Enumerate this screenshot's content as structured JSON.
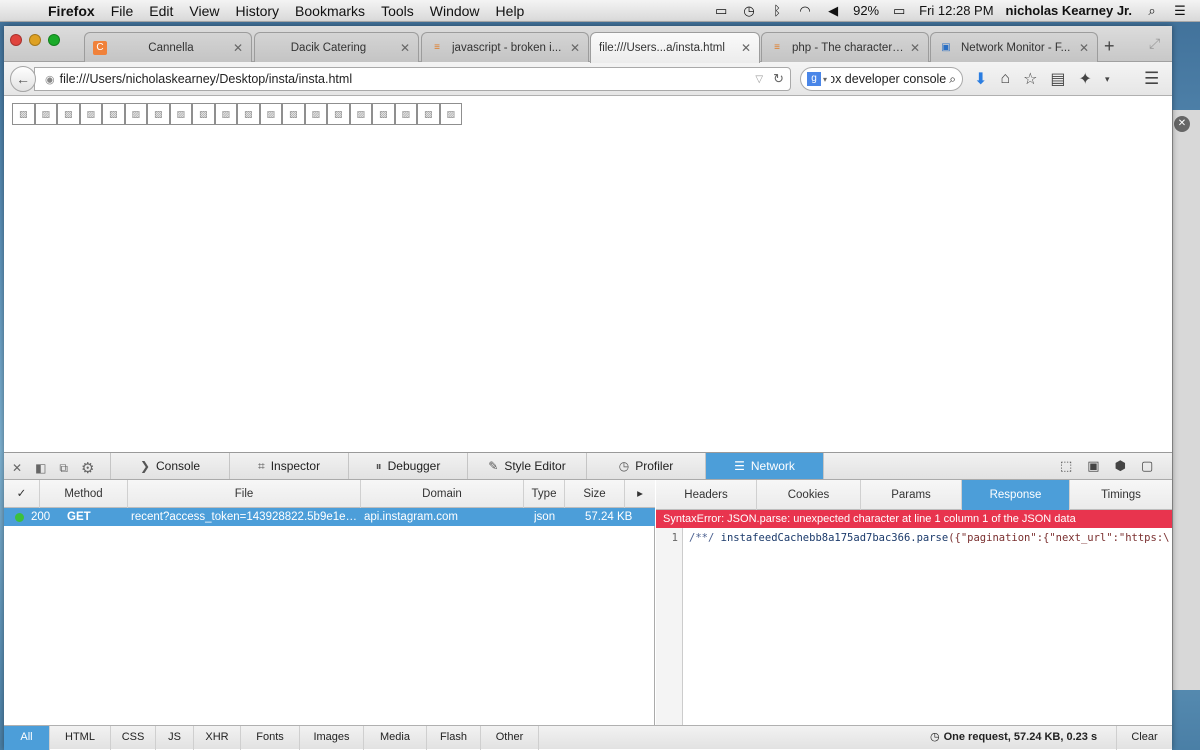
{
  "menubar": {
    "app": "Firefox",
    "items": [
      "File",
      "Edit",
      "View",
      "History",
      "Bookmarks",
      "Tools",
      "Window",
      "Help"
    ],
    "battery": "92%",
    "clock": "Fri 12:28 PM",
    "user": "nicholas Kearney Jr."
  },
  "tabs": [
    {
      "title": "Cannella",
      "favicon": "C"
    },
    {
      "title": "Dacik Catering",
      "favicon": ""
    },
    {
      "title": "javascript - broken i...",
      "favicon": "≡"
    },
    {
      "title": "file:///Users...a/insta.html",
      "favicon": ""
    },
    {
      "title": "php - The character ...",
      "favicon": "≡"
    },
    {
      "title": "Network Monitor - F...",
      "favicon": "▣"
    }
  ],
  "navbar": {
    "url": "file:///Users/nicholaskearney/Desktop/insta/insta.html",
    "search_query": "firefox developer console"
  },
  "page": {
    "broken_image_count": 20
  },
  "devtools": {
    "tabs": [
      "Console",
      "Inspector",
      "Debugger",
      "Style Editor",
      "Profiler",
      "Network"
    ],
    "active_tab": "Network",
    "columns": {
      "check": "✓",
      "method": "Method",
      "file": "File",
      "domain": "Domain",
      "type": "Type",
      "size": "Size"
    },
    "request": {
      "status": "200",
      "method": "GET",
      "file": "recent?access_token=143928822.5b9e1e6...",
      "domain": "api.instagram.com",
      "type": "json",
      "size": "57.24 KB"
    },
    "side_tabs": [
      "Headers",
      "Cookies",
      "Params",
      "Response",
      "Timings"
    ],
    "active_side_tab": "Response",
    "error": "SyntaxError: JSON.parse: unexpected character at line 1 column 1 of the JSON data",
    "response_line_no": "1",
    "response_comment": "/**/",
    "response_callback": "instafeedCachebb8a175ad7bac366.parse",
    "response_rest": "({\"pagination\":{\"next_url\":\"https:\\/\\/",
    "filters": [
      "All",
      "HTML",
      "CSS",
      "JS",
      "XHR",
      "Fonts",
      "Images",
      "Media",
      "Flash",
      "Other"
    ],
    "active_filter": "All",
    "summary": "One request, 57.24 KB, 0.23 s",
    "clear_label": "Clear"
  },
  "colors": {
    "devtools_accent": "#4c9ed9",
    "error_bar": "#e8344e",
    "status_dot": "#3cc03c"
  }
}
